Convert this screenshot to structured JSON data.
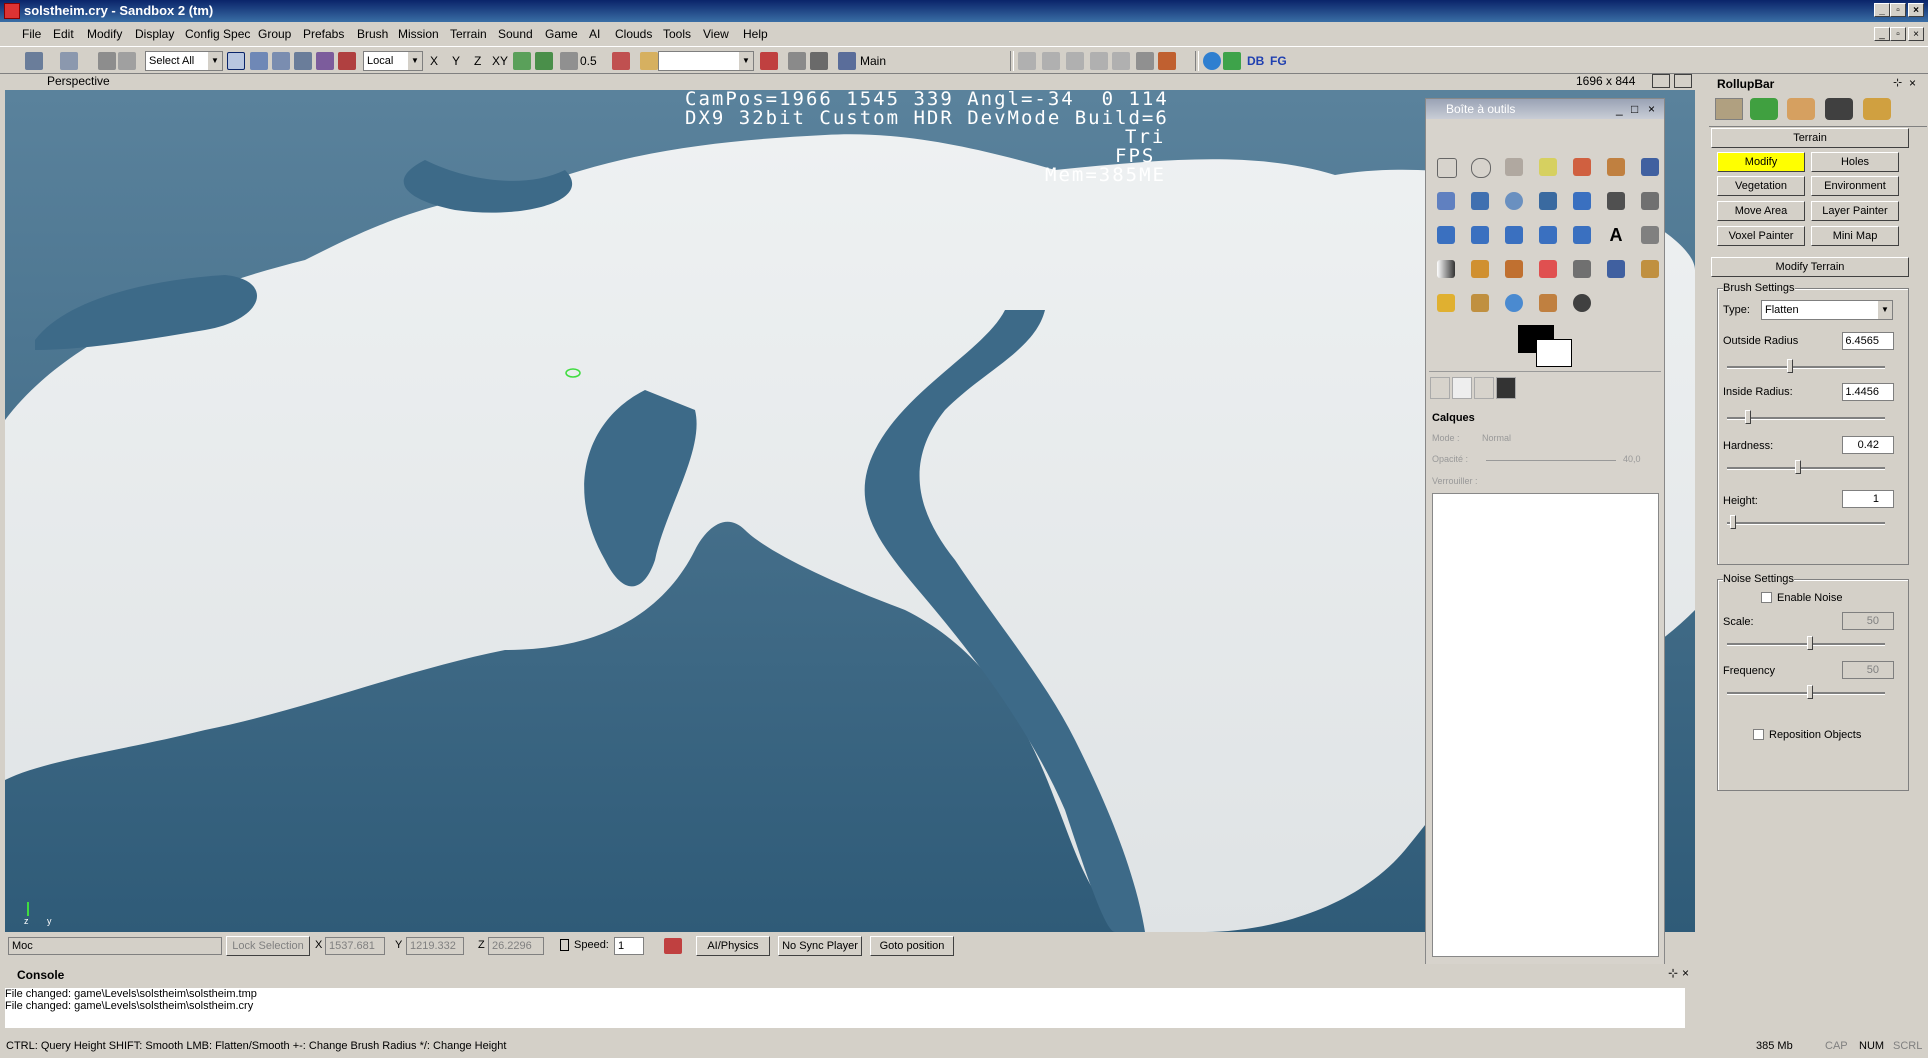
{
  "window": {
    "title": "solstheim.cry - Sandbox 2 (tm)"
  },
  "menu": [
    "File",
    "Edit",
    "Modify",
    "Display",
    "Config Spec",
    "Group",
    "Prefabs",
    "Brush",
    "Mission",
    "Terrain",
    "Sound",
    "Game",
    "AI",
    "Clouds",
    "Tools",
    "View",
    "Help"
  ],
  "toolbar": {
    "select_all": "Select All",
    "coord_system": "Local",
    "axis_x": "X",
    "axis_y": "Y",
    "axis_z": "Z",
    "axis_xy": "XY",
    "grid": "0.5",
    "layer": "Main",
    "db": "DB",
    "fg": "FG"
  },
  "viewport": {
    "label": "Perspective",
    "resolution": "1696 x 844",
    "osd_line1": "CamPos=1966 1545 339 Angl=-34  0 114",
    "osd_line2": "DX9 32bit Custom HDR DevMode Build=6",
    "osd_line3": "Tri",
    "osd_line4": "FPS",
    "osd_line5": "Mem=385ME",
    "axis_z": "z",
    "axis_y": "y"
  },
  "vpstatus": {
    "moc": "Moc",
    "lock_selection": "Lock Selection",
    "x_label": "X",
    "x_value": "1537.681",
    "y_label": "Y",
    "y_value": "1219.332",
    "z_label": "Z",
    "z_value": "26.2296",
    "speed_label": "Speed:",
    "speed_value": "1",
    "ai_physics": "AI/Physics",
    "no_sync": "No Sync Player",
    "goto": "Goto position"
  },
  "console": {
    "title": "Console",
    "lines": [
      "File changed: game\\Levels\\solstheim\\solstheim.tmp",
      "File changed: game\\Levels\\solstheim\\solstheim.cry"
    ]
  },
  "statusbar": {
    "hint": "CTRL: Query Height  SHIFT: Smooth  LMB: Flatten/Smooth  +-: Change Brush Radius  */: Change Height",
    "memory": "385 Mb",
    "cap": "CAP",
    "num": "NUM",
    "scrl": "SCRL"
  },
  "gimp": {
    "title": "Boîte à outils",
    "layers_title": "Calques",
    "mode_label": "Mode :",
    "mode_value": "Normal",
    "opacity_label": "Opacité :",
    "opacity_value": "40,0",
    "lock_label": "Verrouiller :"
  },
  "rollup": {
    "title": "RollupBar",
    "section": "Terrain",
    "buttons": [
      "Modify",
      "Holes",
      "Vegetation",
      "Environment",
      "Move Area",
      "Layer Painter",
      "Voxel Painter",
      "Mini Map"
    ],
    "modify_terrain": "Modify Terrain",
    "brush_settings": "Brush Settings",
    "type_label": "Type:",
    "type_value": "Flatten",
    "outside_radius_label": "Outside Radius",
    "outside_radius_value": "6.4565",
    "inside_radius_label": "Inside Radius:",
    "inside_radius_value": "1.4456",
    "hardness_label": "Hardness:",
    "hardness_value": "0.42",
    "height_label": "Height:",
    "height_value": "1",
    "noise_settings": "Noise Settings",
    "enable_noise": "Enable Noise",
    "scale_label": "Scale:",
    "scale_value": "50",
    "frequency_label": "Frequency",
    "frequency_value": "50",
    "reposition": "Reposition Objects"
  },
  "colors": {
    "water": "#3b6886",
    "snow": "#e4e8ea",
    "highlight": "#ffff00",
    "titlebar": "#0a246a"
  }
}
